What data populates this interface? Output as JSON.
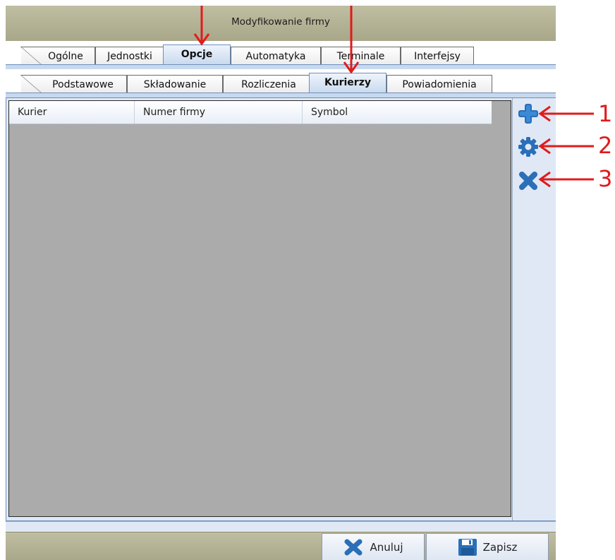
{
  "window": {
    "title": "Modyfikowanie firmy"
  },
  "main_tabs": [
    {
      "label": "Ogólne"
    },
    {
      "label": "Jednostki"
    },
    {
      "label": "Opcje",
      "active": true
    },
    {
      "label": "Automatyka"
    },
    {
      "label": "Terminale"
    },
    {
      "label": "Interfejsy"
    }
  ],
  "sub_tabs": [
    {
      "label": "Podstawowe"
    },
    {
      "label": "Składowanie"
    },
    {
      "label": "Rozliczenia"
    },
    {
      "label": "Kurierzy",
      "active": true
    },
    {
      "label": "Powiadomienia"
    }
  ],
  "grid": {
    "columns": [
      "Kurier",
      "Numer  firmy",
      "Symbol"
    ],
    "rows": []
  },
  "side_actions": [
    {
      "icon": "plus-icon",
      "annotation": "1"
    },
    {
      "icon": "gear-icon",
      "annotation": "2"
    },
    {
      "icon": "x-icon",
      "annotation": "3"
    }
  ],
  "buttons": {
    "cancel": "Anuluj",
    "save": "Zapisz"
  },
  "colors": {
    "title_bar": "#b5b395",
    "tab_active": "#c8d9ee",
    "grid_background": "#ababab",
    "icon_blue": "#2a6fb8",
    "annotation_red": "#e01b1b"
  }
}
